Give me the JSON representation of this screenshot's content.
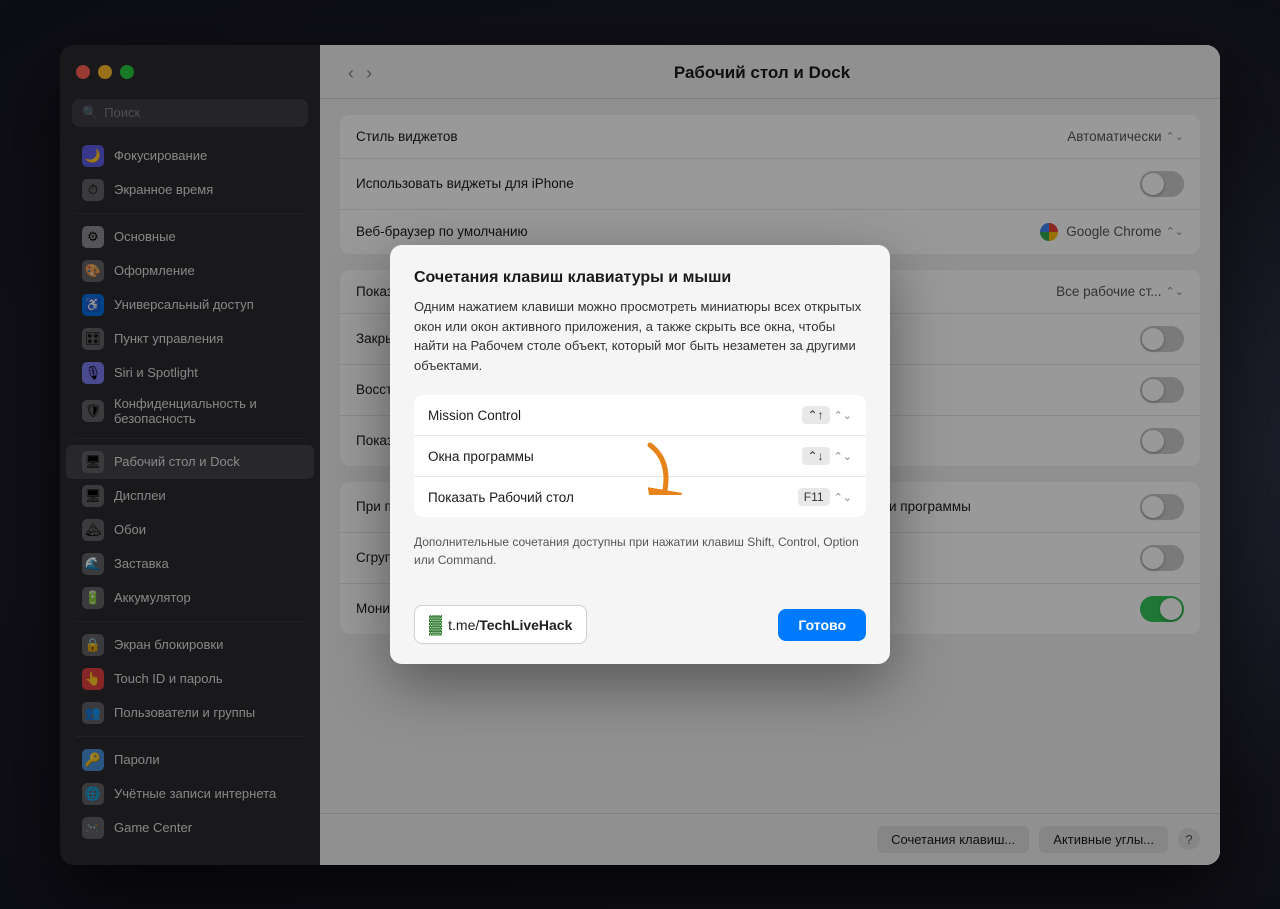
{
  "window": {
    "title": "Рабочий стол и Dock"
  },
  "trafficLights": {
    "close": "close",
    "minimize": "minimize",
    "maximize": "maximize"
  },
  "sidebar": {
    "searchPlaceholder": "Поиск",
    "items": [
      {
        "id": "focus",
        "label": "Фокусирование",
        "icon": "🌙",
        "iconBg": "#5e5ce6"
      },
      {
        "id": "screentime",
        "label": "Экранное время",
        "icon": "⏱",
        "iconBg": "#666"
      },
      {
        "id": "general",
        "label": "Основные",
        "icon": "⚙",
        "iconBg": "#8e8e93"
      },
      {
        "id": "appearance",
        "label": "Оформление",
        "icon": "🎨",
        "iconBg": "#636366"
      },
      {
        "id": "accessibility",
        "label": "Универсальный доступ",
        "icon": "♿",
        "iconBg": "#0071e3"
      },
      {
        "id": "control",
        "label": "Пункт управления",
        "icon": "🎛",
        "iconBg": "#636366"
      },
      {
        "id": "siri",
        "label": "Siri и Spotlight",
        "icon": "🎙",
        "iconBg": "#7c7cf0"
      },
      {
        "id": "privacy",
        "label": "Конфиденциальность и безопасность",
        "icon": "🔒",
        "iconBg": "#636366"
      },
      {
        "id": "desktop",
        "label": "Рабочий стол и Dock",
        "icon": "🖥",
        "iconBg": "#636366",
        "active": true
      },
      {
        "id": "displays",
        "label": "Дисплеи",
        "icon": "🖥",
        "iconBg": "#636366"
      },
      {
        "id": "wallpaper",
        "label": "Обои",
        "icon": "🏔",
        "iconBg": "#636366"
      },
      {
        "id": "screensaver",
        "label": "Заставка",
        "icon": "🌊",
        "iconBg": "#636366"
      },
      {
        "id": "battery",
        "label": "Аккумулятор",
        "icon": "🔋",
        "iconBg": "#636366"
      },
      {
        "id": "lock",
        "label": "Экран блокировки",
        "icon": "🔒",
        "iconBg": "#636366"
      },
      {
        "id": "touchid",
        "label": "Touch ID и пароль",
        "icon": "👆",
        "iconBg": "#e04040"
      },
      {
        "id": "users",
        "label": "Пользователи и группы",
        "icon": "👥",
        "iconBg": "#636366"
      },
      {
        "id": "passwords",
        "label": "Пароли",
        "icon": "🔑",
        "iconBg": "#4a90d9"
      },
      {
        "id": "accounts",
        "label": "Учётные записи интернета",
        "icon": "🌐",
        "iconBg": "#636366"
      },
      {
        "id": "gamecenter",
        "label": "Game Center",
        "icon": "🎮",
        "iconBg": "#636366"
      }
    ]
  },
  "mainContent": {
    "title": "Рабочий стол и Dock",
    "rows": [
      {
        "label": "Стиль виджетов",
        "type": "select",
        "value": "Автоматически"
      },
      {
        "label": "Использовать виджеты для iPhone",
        "type": "toggle",
        "value": false
      },
      {
        "label": "Веб-браузер по умолчанию",
        "type": "select-chrome",
        "value": "Google Chrome"
      },
      {
        "label": "Показывать элементы в полноэкранном режиме",
        "type": "select",
        "value": ""
      },
      {
        "label": "Закрыть документов",
        "type": "toggle",
        "value": false
      },
      {
        "label": "",
        "type": "toggle",
        "value": false
      },
      {
        "label": "Показывать миниатюры",
        "type": "toggle",
        "value": false
      },
      {
        "label": "При переключении на программу переключаться в пространство с открытыми окнами программы",
        "type": "toggle",
        "value": false
      },
      {
        "label": "Сгруппировать окна по программам",
        "type": "toggle",
        "value": false
      },
      {
        "label": "Мониторы с разными рабочими пространствами Spaces",
        "type": "toggle",
        "value": true
      }
    ],
    "bottomBar": {
      "btnShortcuts": "Сочетания клавиш...",
      "btnActiveCorners": "Активные углы...",
      "btnHelp": "?"
    }
  },
  "modal": {
    "title": "Сочетания клавиш клавиатуры и мыши",
    "description": "Одним нажатием клавиши можно просмотреть миниатюры всех открытых окон или окон активного приложения, а также скрыть все окна, чтобы найти на Рабочем столе объект, который мог быть незаметен за другими объектами.",
    "rows": [
      {
        "label": "Mission Control",
        "value": "⌃↑",
        "hasDropdown": true
      },
      {
        "label": "Окна программы",
        "value": "⌃↓",
        "hasDropdown": true
      },
      {
        "label": "Показать Рабочий стол",
        "value": "F11",
        "hasDropdown": true
      }
    ],
    "note": "Дополнительные сочетания доступны при нажатии клавиш Shift, Control, Option или Command.",
    "watermark": "t.me/TechLiveHack",
    "doneButton": "Готово"
  }
}
